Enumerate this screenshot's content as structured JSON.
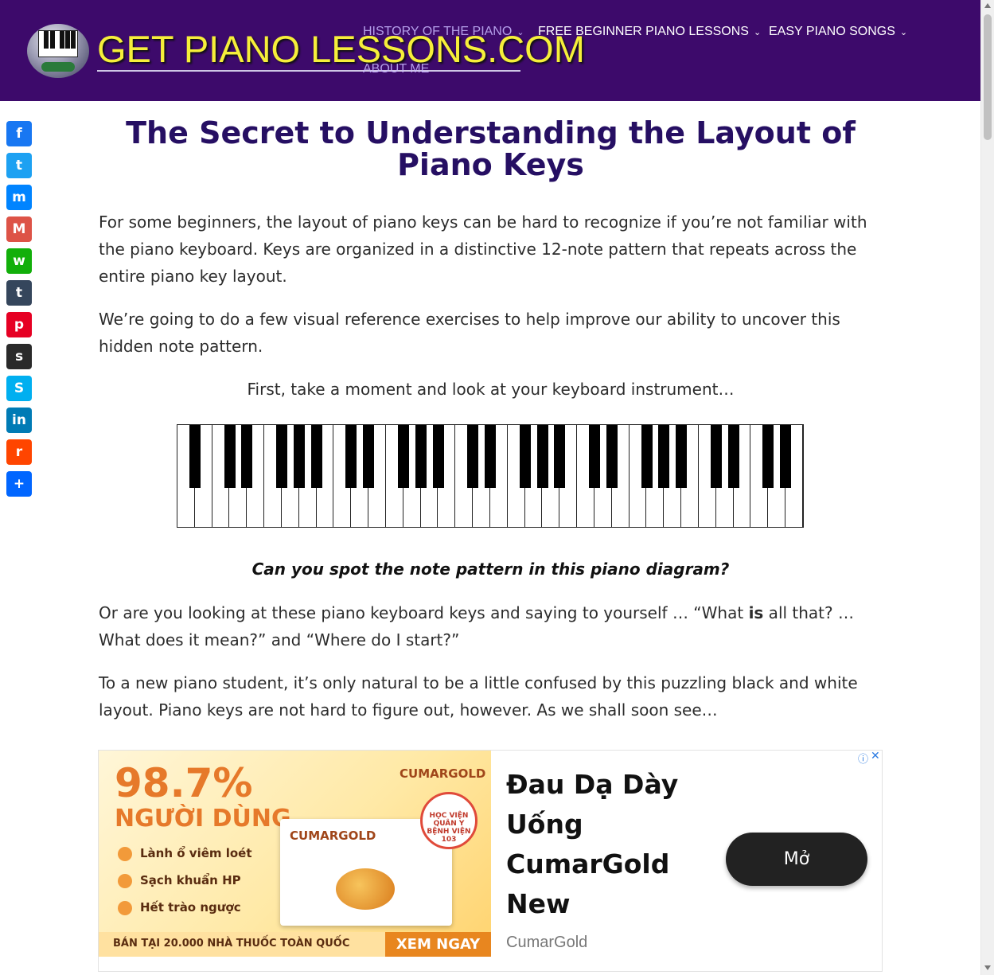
{
  "header": {
    "logo_text": "GET PIANO LESSONS.COM",
    "nav": [
      {
        "label": "HISTORY OF THE PIANO",
        "chevron": "⌄"
      },
      {
        "label": "FREE BEGINNER PIANO LESSONS",
        "chevron": "⌄"
      },
      {
        "label": "EASY PIANO SONGS",
        "chevron": "⌄"
      },
      {
        "label": "ABOUT ME"
      }
    ]
  },
  "share": {
    "buttons": [
      {
        "name": "facebook",
        "glyph": "f",
        "color": "#1877f2"
      },
      {
        "name": "twitter",
        "glyph": "t",
        "color": "#1da1f2"
      },
      {
        "name": "messenger",
        "glyph": "m",
        "color": "#0084ff"
      },
      {
        "name": "gmail",
        "glyph": "M",
        "color": "#dd5347"
      },
      {
        "name": "whatsapp",
        "glyph": "w",
        "color": "#12af0a"
      },
      {
        "name": "tumblr",
        "glyph": "t",
        "color": "#35465c"
      },
      {
        "name": "pinterest",
        "glyph": "p",
        "color": "#e60023"
      },
      {
        "name": "snapchat",
        "glyph": "s",
        "color": "#2a2a2a"
      },
      {
        "name": "skype",
        "glyph": "S",
        "color": "#00aff0"
      },
      {
        "name": "linkedin",
        "glyph": "in",
        "color": "#007bb5"
      },
      {
        "name": "reddit",
        "glyph": "r",
        "color": "#ff4500"
      },
      {
        "name": "share",
        "glyph": "+",
        "color": "#0166ff"
      }
    ]
  },
  "article": {
    "title": "The Secret to Understanding the Layout of Piano Keys",
    "p1": "For some beginners, the layout of piano keys can be hard to recognize if you’re not familiar with the piano keyboard. Keys are organized in a distinctive 12-note pattern that repeats across the entire piano key layout.",
    "p2": "We’re going to do a few visual reference exercises to help improve our ability to uncover this hidden note pattern.",
    "p3": "First, take a moment and look at your keyboard instrument…",
    "caption": "Can you spot the note pattern in this piano diagram?",
    "p4_before": "Or are you looking at these piano keyboard keys and saying to yourself … “What ",
    "p4_bold": "is",
    "p4_after": " all that? … What does it mean?” and “Where do I start?”",
    "p5": "To a new piano student, it’s only natural to be a little confused by this puzzling black and white layout. Piano keys are not hard to figure out, however. As we shall soon see…"
  },
  "ad": {
    "percent": "98.7%",
    "users": "NGƯỜI DÙNG",
    "features": [
      "Lành ổ viêm loét",
      "Sạch khuẩn HP",
      "Hết trào ngược"
    ],
    "brand": "CUMARGOLD",
    "box_brand": "CUMARGOLD",
    "seal": "HỌC VIỆN QUÂN Y BỆNH VIỆN 103",
    "strip": "BÁN TẠI 20.000 NHÀ THUỐC TOÀN QUỐC",
    "strip_cta": "XEM NGAY",
    "headline": "Đau Dạ Dày Uống CumarGold New",
    "source": "CumarGold",
    "open_label": "Mở",
    "info_glyph": "ⓘ",
    "close_glyph": "✕"
  }
}
